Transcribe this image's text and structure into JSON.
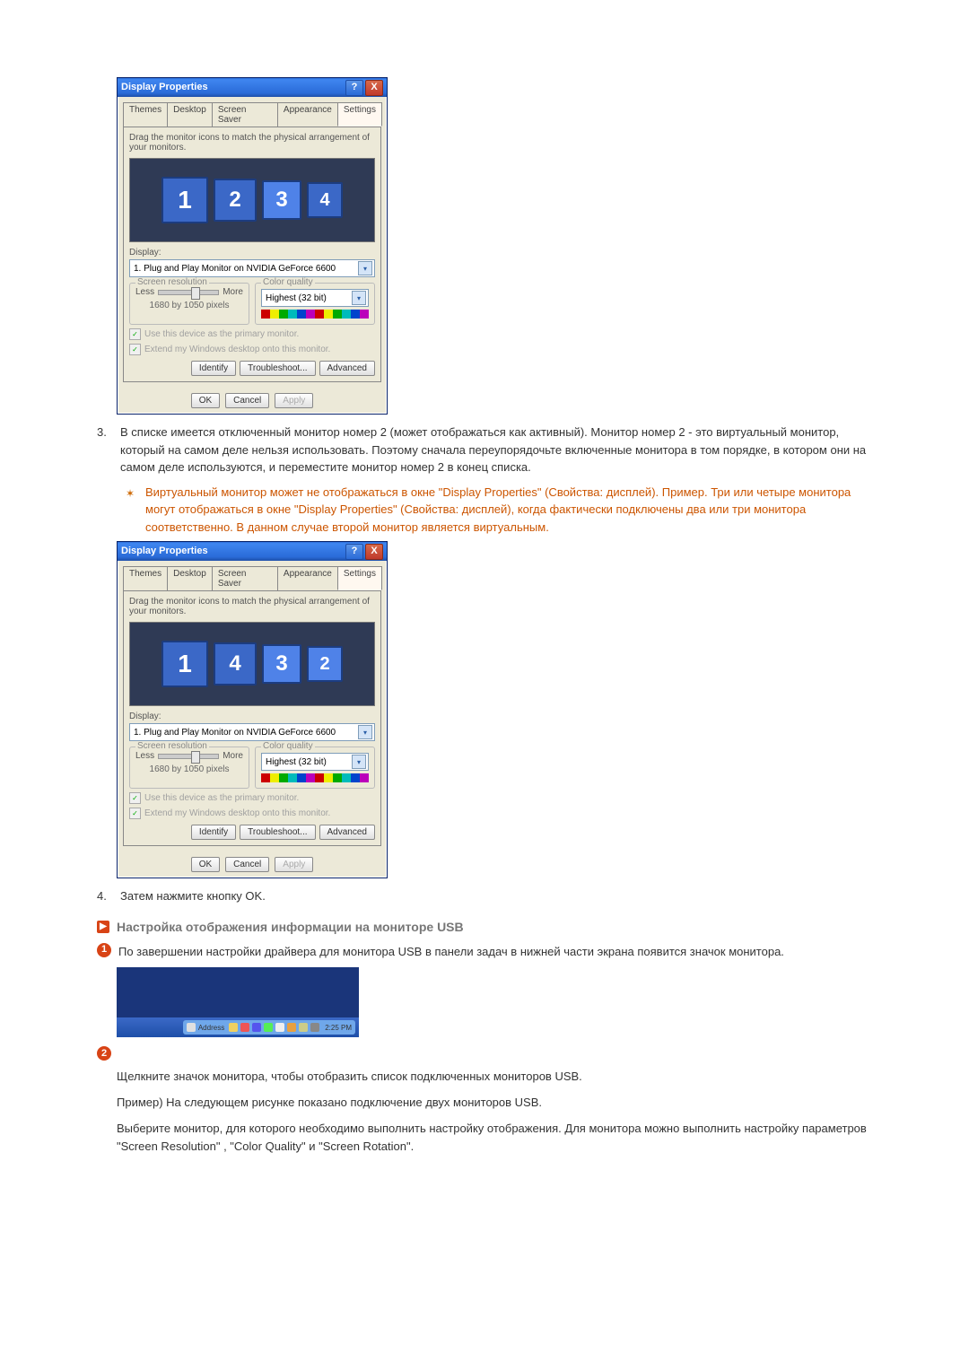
{
  "dialog": {
    "title": "Display Properties",
    "close": "X",
    "help": "?",
    "tabs": [
      "Themes",
      "Desktop",
      "Screen Saver",
      "Appearance",
      "Settings"
    ],
    "active_tab": "Settings",
    "drag_hint": "Drag the monitor icons to match the physical arrangement of your monitors.",
    "display_label": "Display:",
    "display_value": "1. Plug and Play Monitor on NVIDIA GeForce 6600",
    "res_label": "Screen resolution",
    "less": "Less",
    "more": "More",
    "res_value": "1680 by 1050 pixels",
    "cq_label": "Color quality",
    "cq_value": "Highest (32 bit)",
    "chk1": "Use this device as the primary monitor.",
    "chk2": "Extend my Windows desktop onto this monitor.",
    "identify": "Identify",
    "troubleshoot": "Troubleshoot...",
    "advanced": "Advanced",
    "ok": "OK",
    "cancel": "Cancel",
    "apply": "Apply"
  },
  "monitors_a": [
    "1",
    "2",
    "3",
    "4"
  ],
  "monitors_b": [
    "1",
    "4",
    "3",
    "2"
  ],
  "para3_num": "3.",
  "para3": "В списке имеется отключенный монитор номер 2 (может отображаться как активный). Монитор номер 2 - это виртуальный монитор, который на самом деле нельзя использовать. Поэтому сначала переупорядочьте включенные монитора в том порядке, в котором они на самом деле используются, и переместите монитор номер 2 в конец списка.",
  "bullet_a": "Виртуальный монитор может не отображаться в окне \"Display Properties\" (Свойства: дисплей). Пример. Три или четыре монитора могут отображаться в окне \"Display Properties\" (Свойства: дисплей), когда фактически подключены два или три монитора соответственно. В данном случае второй монитор является виртуальным.",
  "para4_num": "4.",
  "para4": "Затем нажмите кнопку OK.",
  "section_title": "Настройка отображения информации на мониторе USB",
  "badge1": "1",
  "badge1_text": "По завершении настройки драйвера для монитора USB в панели задач в нижней части экрана появится значок монитора.",
  "badge2": "2",
  "tray": {
    "label": "Address",
    "time": "2:25 PM"
  },
  "plain_p1": "Щелкните значок монитора, чтобы отобразить список подключенных мониторов USB.",
  "plain_p2": "Пример) На следующем рисунке показано подключение двух мониторов USB.",
  "plain_p3": "Выберите монитор, для которого необходимо выполнить настройку отображения. Для монитора можно выполнить настройку параметров \"Screen Resolution\" , \"Color Quality\" и \"Screen Rotation\"."
}
